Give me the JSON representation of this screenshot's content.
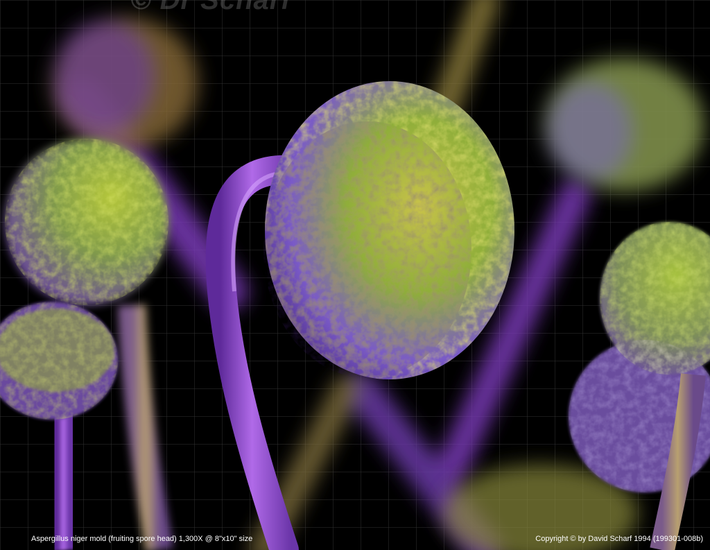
{
  "image": {
    "subject": "Aspergillus niger fruiting spore heads (colorized SEM micrograph)",
    "background_color": "#000000",
    "palette": {
      "stalk": "#9a4fd8",
      "head_green": "#a8c43a",
      "head_purple": "#7a52c8",
      "head_yellow": "#c9a634",
      "grid": "#5a5a5a"
    }
  },
  "caption": {
    "left": "Aspergillus niger mold (fruiting spore head)  1,300X @ 8\"x10\" size",
    "right": "Copyright © by David Scharf 1994 (199301-008b)"
  },
  "watermark": {
    "text": "© Dr Scharf"
  }
}
